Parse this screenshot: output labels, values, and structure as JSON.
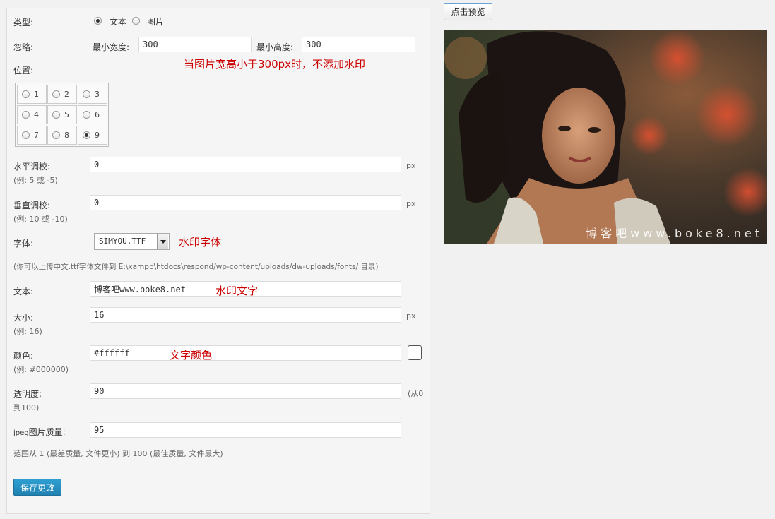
{
  "form": {
    "type": {
      "label": "类型:",
      "option_text": "文本",
      "option_image": "图片",
      "selected": "text"
    },
    "ignore": {
      "label": "忽略:",
      "min_width_label": "最小宽度:",
      "min_width_value": "300",
      "min_height_label": "最小高度:",
      "min_height_value": "300",
      "note": "当图片宽高小于300px时，不添加水印"
    },
    "position": {
      "label": "位置:",
      "cells": [
        "1",
        "2",
        "3",
        "4",
        "5",
        "6",
        "7",
        "8",
        "9"
      ],
      "selected": "9"
    },
    "h_adjust": {
      "label": "水平调校:",
      "value": "0",
      "unit": "px",
      "hint": "(例: 5 或 -5)"
    },
    "v_adjust": {
      "label": "垂直调校:",
      "value": "0",
      "unit": "px",
      "hint": "(例: 10 或 -10)"
    },
    "font": {
      "label": "字体:",
      "value": "SIMYOU.TTF",
      "note": "水印字体",
      "hint": "(你可以上传中文.ttf字体文件到 E:\\xampp\\htdocs\\respond/wp-content/uploads/dw-uploads/fonts/ 目录)"
    },
    "text": {
      "label": "文本:",
      "value": "博客吧www.boke8.net",
      "note": "水印文字"
    },
    "size": {
      "label": "大小:",
      "value": "16",
      "unit": "px",
      "hint": "(例: 16)"
    },
    "color": {
      "label": "颜色:",
      "value": "#ffffff",
      "note": "文字颜色",
      "hint": "(例: #000000)",
      "swatch": "#ffffff"
    },
    "opacity": {
      "label": "透明度:",
      "value": "90",
      "hint_a": "(从0",
      "hint_b": "到100)"
    },
    "jpeg_quality": {
      "label_prefix": "jpeg",
      "label": "图片质量:",
      "value": "95",
      "hint": "范围从 1 (最差质量, 文件更小) 到 100 (最佳质量, 文件最大)"
    },
    "save_button": "保存更改"
  },
  "preview": {
    "button": "点击预览",
    "watermark": "博客吧www.boke8.net"
  },
  "colors": {
    "note": "#cc0000",
    "primary": "#2585b9",
    "panel": "#f5f5f5"
  }
}
